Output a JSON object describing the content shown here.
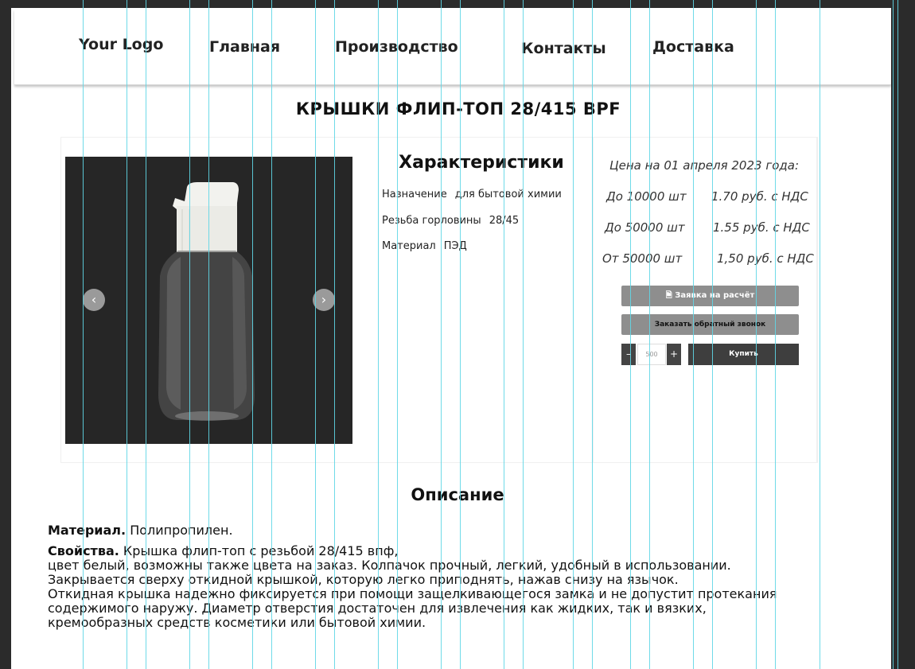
{
  "header": {
    "logo": "Your Logo",
    "nav": [
      "Главная",
      "Производство",
      "Контакты",
      "Доставка"
    ]
  },
  "product": {
    "title": "КРЫШКИ ФЛИП-ТОП 28/415 BPF",
    "gallery": {
      "prev_icon": "‹",
      "next_icon": "›"
    }
  },
  "specs": {
    "title": "Характеристики",
    "rows": [
      {
        "label": "Назначение",
        "value": "для бытовой химии"
      },
      {
        "label": "Резьба горловины",
        "value": "28/45"
      },
      {
        "label": "Материал",
        "value": "ПЭД"
      }
    ]
  },
  "prices": {
    "heading": "Цена на 01 апреля 2023 года:",
    "rows": [
      {
        "qty": "До 10000 шт",
        "price": "1.70 руб. с НДС"
      },
      {
        "qty": "До 50000 шт",
        "price": "1.55 руб. с НДС"
      },
      {
        "qty": "От 50000 шт",
        "price": "1,50 руб. с НДС"
      }
    ],
    "calc_button": "Заявка на расчёт",
    "callback_button": "Заказать обратный звонок",
    "minus": "–",
    "plus": "+",
    "quantity": "500",
    "buy_button": "Купить"
  },
  "description": {
    "title": "Описание",
    "material_label": "Материал.",
    "material_text": "Полипропилен.",
    "properties_label": "Свойства.",
    "properties_first": "Крышка флип-топ с резьбой 28/415 впф,",
    "properties_lines": [
      "цвет белый, возможны также цвета на заказ. Колпачок прочный, легкий, удобный в использовании.",
      "Закрывается сверху откидной крышкой, которую легко приподнять, нажав снизу на язычок.",
      "Откидная крышка надежно фиксируется при помощи защелкивающегося замка и не допустит протекания",
      "содержимого наружу. Диаметр отверстия достаточен для извлечения как жидких, так и вязких,",
      "кремообразных средств косметики или бытовой химии."
    ]
  },
  "colors": {
    "accent_guides": "#5fd6e6",
    "button_gray": "#8e8e8e",
    "button_dark": "#3e3e3e"
  }
}
